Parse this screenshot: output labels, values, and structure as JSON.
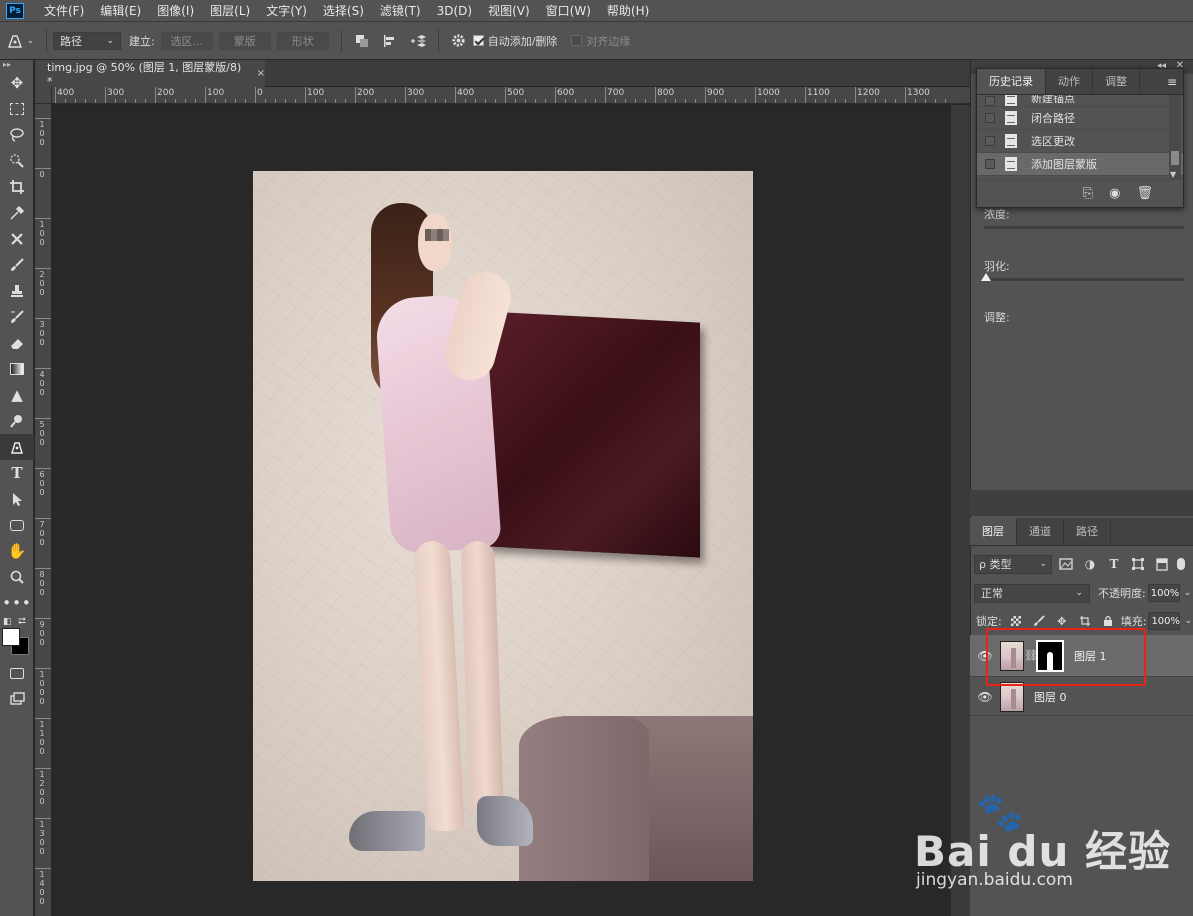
{
  "app": {
    "logo": "Ps"
  },
  "menu": [
    "文件(F)",
    "编辑(E)",
    "图像(I)",
    "图层(L)",
    "文字(Y)",
    "选择(S)",
    "滤镜(T)",
    "3D(D)",
    "视图(V)",
    "窗口(W)",
    "帮助(H)"
  ],
  "options": {
    "mode_value": "路径",
    "build_label": "建立:",
    "btn_selection": "选区...",
    "btn_mask": "蒙版",
    "btn_shape": "形状",
    "auto_add_label": "自动添加/删除",
    "align_edges_label": "对齐边缘"
  },
  "document": {
    "tab_title": "timg.jpg @ 50% (图层 1, 图层蒙版/8) *",
    "close": "×"
  },
  "ruler": {
    "top_labels": [
      "400",
      "300",
      "200",
      "100",
      "0",
      "100",
      "200",
      "300",
      "400",
      "500",
      "600",
      "700",
      "800",
      "900",
      "1000",
      "1100",
      "1200",
      "1300"
    ],
    "left_labels": [
      "100",
      "0",
      "100",
      "200",
      "300",
      "400",
      "500",
      "600",
      "700",
      "800",
      "900",
      "1000",
      "1100",
      "1200",
      "1300",
      "1400"
    ]
  },
  "history": {
    "tabs": [
      "历史记录",
      "动作",
      "调整"
    ],
    "active_tab": 0,
    "items": [
      "新建锚点",
      "闭合路径",
      "选区更改",
      "添加图层蒙版"
    ],
    "selected_index": 3
  },
  "properties": {
    "density_label": "浓度:",
    "feather_label": "羽化:",
    "refine_label": "调整:"
  },
  "layers": {
    "tabs": [
      "图层",
      "通道",
      "路径"
    ],
    "active_tab": 0,
    "filter_value": "ρ 类型",
    "blend_mode": "正常",
    "opacity_label": "不透明度:",
    "opacity_value": "100%",
    "lock_label": "锁定:",
    "fill_label": "填充:",
    "fill_value": "100%",
    "items": [
      {
        "name": "图层 1",
        "has_mask": true,
        "selected": true
      },
      {
        "name": "图层 0",
        "has_mask": false,
        "selected": false
      }
    ]
  },
  "watermark": {
    "text": "Bai du 经验",
    "url": "jingyan.baidu.com"
  },
  "colors": {
    "foreground": "#ffffff",
    "background": "#000000",
    "highlight": "#e8231a"
  },
  "icons": {
    "tools": [
      "move-icon",
      "marquee-icon",
      "lasso-icon",
      "quick-select-icon",
      "crop-icon",
      "eyedropper-icon",
      "healing-brush-icon",
      "brush-icon",
      "stamp-icon",
      "history-brush-icon",
      "eraser-icon",
      "gradient-icon",
      "blur-icon",
      "dodge-icon",
      "pen-icon",
      "type-icon",
      "path-select-icon",
      "rectangle-icon",
      "hand-icon",
      "zoom-icon",
      "more-icon"
    ]
  }
}
